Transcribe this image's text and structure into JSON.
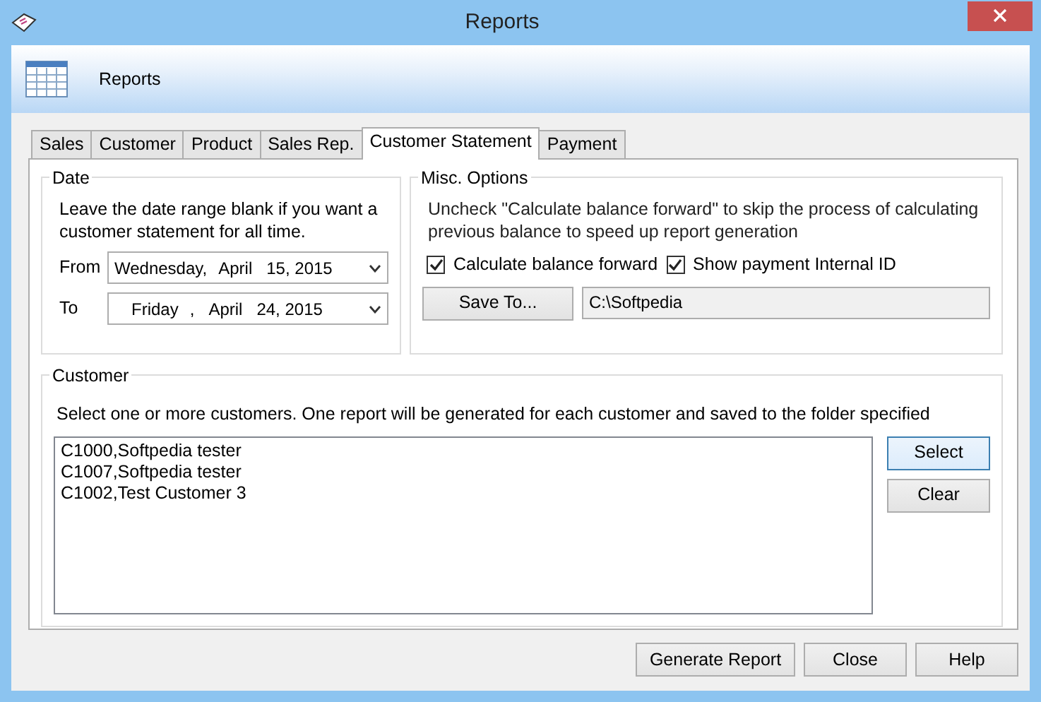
{
  "window": {
    "title": "Reports"
  },
  "header": {
    "title": "Reports"
  },
  "tabs": [
    {
      "label": "Sales",
      "selected": false
    },
    {
      "label": "Customer",
      "selected": false
    },
    {
      "label": "Product",
      "selected": false
    },
    {
      "label": "Sales Rep.",
      "selected": false
    },
    {
      "label": "Customer Statement",
      "selected": true
    },
    {
      "label": "Payment",
      "selected": false
    }
  ],
  "date_group": {
    "title": "Date",
    "hint": "Leave the date range blank if you want a customer statement for all time.",
    "fields": [
      {
        "label": "From",
        "parts": [
          "Wednesday,",
          "April",
          "15, 2015"
        ]
      },
      {
        "label": "To",
        "parts": [
          "Friday",
          ",",
          "April",
          "24, 2015"
        ]
      }
    ]
  },
  "misc_options": {
    "title": "Misc. Options",
    "hint": "Uncheck \"Calculate balance forward\" to skip the process of calculating previous balance to speed up report generation",
    "checkboxes": [
      {
        "label": "Calculate balance forward",
        "checked": true
      },
      {
        "label": "Show payment Internal ID",
        "checked": true
      }
    ],
    "save_button": "Save To...",
    "folder": "C:\\Softpedia"
  },
  "customer_group": {
    "title": "Customer",
    "hint": "Select one or more customers. One report will be generated for each customer and saved to the folder specified",
    "customers": [
      "C1000,Softpedia tester",
      "C1007,Softpedia tester",
      "C1002,Test Customer 3"
    ],
    "buttons": [
      {
        "label": "Select",
        "focused": true
      },
      {
        "label": "Clear",
        "focused": false
      }
    ]
  },
  "buttons": [
    "Generate Report",
    "Close",
    "Help"
  ]
}
